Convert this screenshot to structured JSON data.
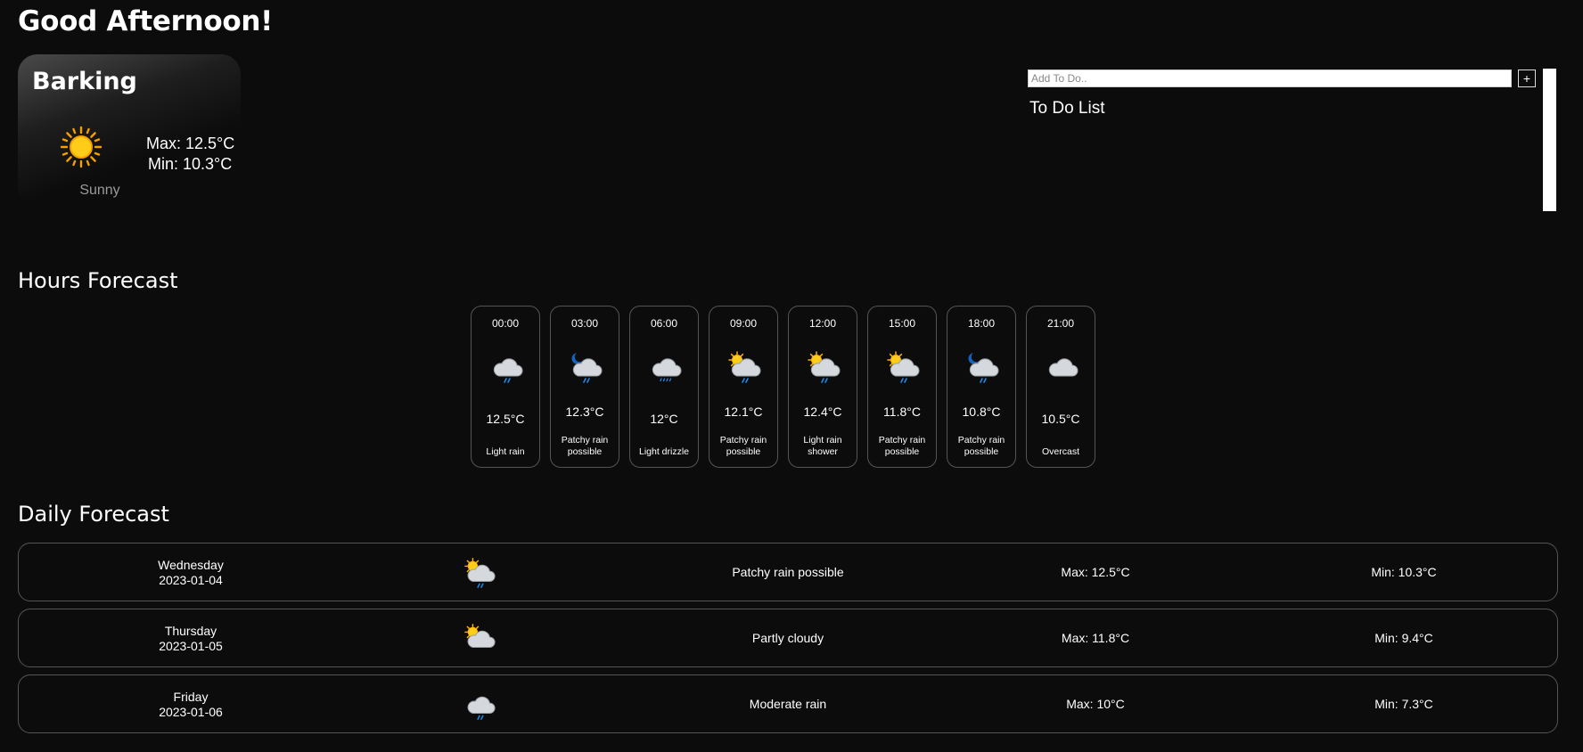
{
  "greeting": "Good Afternoon!",
  "current": {
    "city": "Barking",
    "icon": "sun-icon",
    "condition": "Sunny",
    "max": "Max: 12.5°C",
    "min": "Min: 10.3°C"
  },
  "todo": {
    "placeholder": "Add To Do..",
    "add_label": "+",
    "title": "To Do List"
  },
  "hours_title": "Hours Forecast",
  "hours": [
    {
      "time": "00:00",
      "temp": "12.5°C",
      "condition": "Light rain",
      "icon": "rain-cloud-icon"
    },
    {
      "time": "03:00",
      "temp": "12.3°C",
      "condition": "Patchy rain possible",
      "icon": "moon-rain-cloud-icon"
    },
    {
      "time": "06:00",
      "temp": "12°C",
      "condition": "Light drizzle",
      "icon": "drizzle-cloud-icon"
    },
    {
      "time": "09:00",
      "temp": "12.1°C",
      "condition": "Patchy rain possible",
      "icon": "sun-rain-cloud-icon"
    },
    {
      "time": "12:00",
      "temp": "12.4°C",
      "condition": "Light rain shower",
      "icon": "sun-rain-cloud-icon"
    },
    {
      "time": "15:00",
      "temp": "11.8°C",
      "condition": "Patchy rain possible",
      "icon": "sun-rain-cloud-icon"
    },
    {
      "time": "18:00",
      "temp": "10.8°C",
      "condition": "Patchy rain possible",
      "icon": "moon-rain-cloud-icon"
    },
    {
      "time": "21:00",
      "temp": "10.5°C",
      "condition": "Overcast",
      "icon": "cloud-icon"
    }
  ],
  "daily_title": "Daily Forecast",
  "days": [
    {
      "day": "Wednesday",
      "date": "2023-01-04",
      "condition": "Patchy rain possible",
      "max": "Max: 12.5°C",
      "min": "Min: 10.3°C",
      "icon": "sun-rain-cloud-icon"
    },
    {
      "day": "Thursday",
      "date": "2023-01-05",
      "condition": "Partly cloudy",
      "max": "Max: 11.8°C",
      "min": "Min: 9.4°C",
      "icon": "sun-cloud-icon"
    },
    {
      "day": "Friday",
      "date": "2023-01-06",
      "condition": "Moderate rain",
      "max": "Max: 10°C",
      "min": "Min: 7.3°C",
      "icon": "rain-cloud-icon"
    }
  ],
  "colors": {
    "background": "#0c0c0c",
    "card_border": "#555555",
    "sun": "#ffb300",
    "rain": "#1e88e5",
    "moon": "#1565c0",
    "cloud": "#d5d8dc"
  }
}
